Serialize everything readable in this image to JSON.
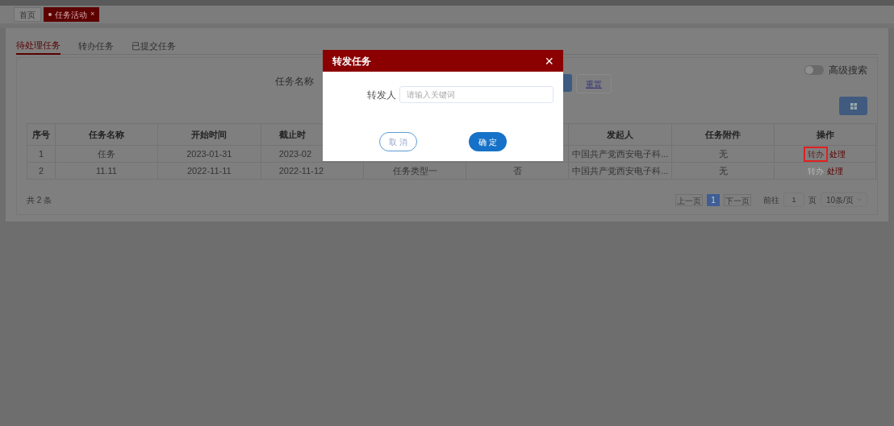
{
  "page_tabs": [
    {
      "label": "首页",
      "selected": false,
      "closable": false
    },
    {
      "label": "任务活动",
      "selected": true,
      "closable": true,
      "close": "×"
    }
  ],
  "tabs": [
    {
      "label": "待处理任务",
      "selected": true
    },
    {
      "label": "转办任务",
      "selected": false
    },
    {
      "label": "已提交任务",
      "selected": false
    }
  ],
  "search": {
    "label": "任务名称",
    "reset": "重置",
    "advanced": {
      "label": "高级搜索",
      "on": false
    }
  },
  "table": {
    "columns": [
      "序号",
      "任务名称",
      "开始时间",
      "截止时",
      "",
      "",
      "发起人",
      "任务附件",
      "操作"
    ],
    "rows": [
      {
        "cells": [
          "1",
          "任务",
          "2023-01-31",
          "2023-02",
          "",
          "",
          "中国共产党西安电子科...",
          "无"
        ],
        "actions": [
          {
            "label": "转办",
            "disabled": false,
            "highlighted": true
          },
          {
            "label": "处理",
            "disabled": false,
            "highlighted": false
          }
        ]
      },
      {
        "cells": [
          "2",
          "11.11",
          "2022-11-11",
          "2022-11-12",
          "任务类型一",
          "否",
          "中国共产党西安电子科...",
          "无"
        ],
        "actions": [
          {
            "label": "转办",
            "disabled": true,
            "highlighted": false
          },
          {
            "label": "处理",
            "disabled": false,
            "highlighted": false
          }
        ]
      }
    ]
  },
  "footer": {
    "total": "共 2 条",
    "prev": "上一页",
    "pages": [
      {
        "label": "1",
        "selected": true
      }
    ],
    "next": "下一页",
    "goto": "前往",
    "page_input": "1",
    "page_unit": "页",
    "page_size": "10条/页"
  },
  "dialog": {
    "title": "转发任务",
    "close": "×",
    "field_label": "转发人",
    "placeholder": "请输入关键词",
    "cancel": "取 消",
    "confirm": "确 定"
  }
}
